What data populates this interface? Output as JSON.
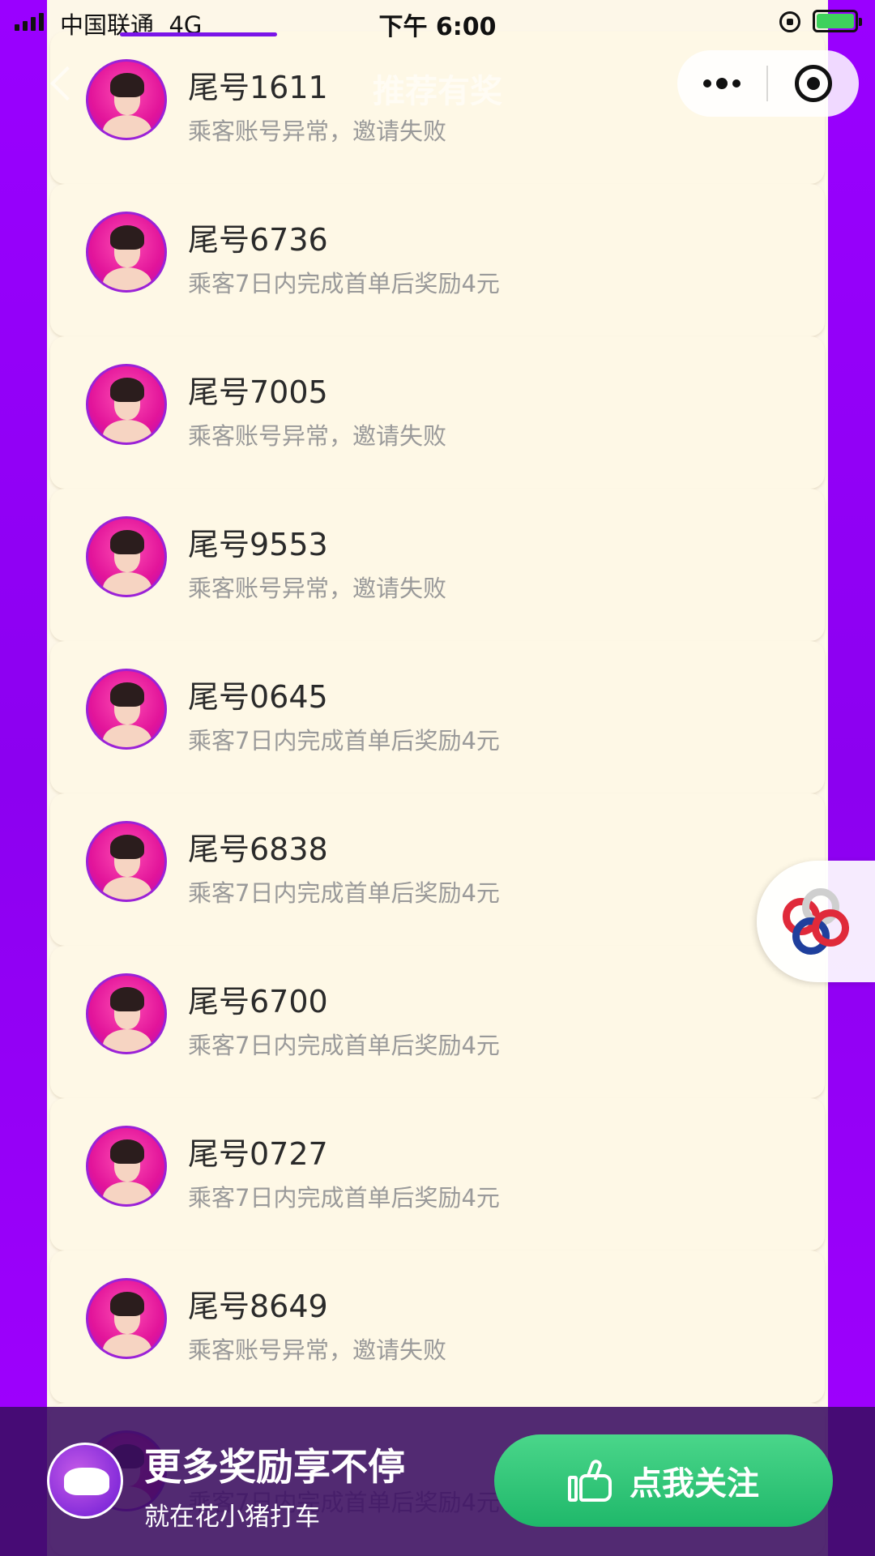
{
  "status_bar": {
    "carrier": "中国联通",
    "network": "4G",
    "time": "下午 6:00"
  },
  "header": {
    "title": "推荐有奖"
  },
  "icons": {
    "back": "back-chevron-icon",
    "more": "more-dots-icon",
    "close": "miniprogram-close-icon",
    "lock": "rotation-lock-icon",
    "battery": "battery-charging-icon",
    "thumb": "thumbs-up-icon"
  },
  "invites": [
    {
      "name": "尾号1611",
      "status": "乘客账号异常，邀请失败"
    },
    {
      "name": "尾号6736",
      "status": "乘客7日内完成首单后奖励4元"
    },
    {
      "name": "尾号7005",
      "status": "乘客账号异常，邀请失败"
    },
    {
      "name": "尾号9553",
      "status": "乘客账号异常，邀请失败"
    },
    {
      "name": "尾号0645",
      "status": "乘客7日内完成首单后奖励4元"
    },
    {
      "name": "尾号6838",
      "status": "乘客7日内完成首单后奖励4元"
    },
    {
      "name": "尾号6700",
      "status": "乘客7日内完成首单后奖励4元"
    },
    {
      "name": "尾号0727",
      "status": "乘客7日内完成首单后奖励4元"
    },
    {
      "name": "尾号8649",
      "status": "乘客账号异常，邀请失败"
    },
    {
      "name": "",
      "status": "乘客7日内完成首单后奖励4元"
    }
  ],
  "promo": {
    "title": "更多奖励享不停",
    "subtitle": "就在花小猪打车",
    "button_label": "点我关注"
  },
  "colors": {
    "background": "#9a00ff",
    "panel": "#fdf7e8",
    "accent_green": "#1fb86a",
    "avatar_pink": "#e2149a"
  }
}
